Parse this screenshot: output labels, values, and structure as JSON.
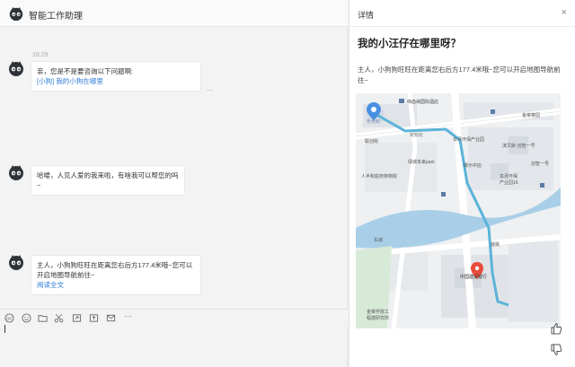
{
  "app": {
    "title": "智能工作助理"
  },
  "chat": {
    "timestamp": "18:29",
    "messages": [
      {
        "line1": "亲，您是不是要咨询以下问题啊:",
        "link": "[小狗] 我的小狗在哪里"
      },
      {
        "text": "哈喽，人见人爱的我来啦，有啥我可以帮您的吗~"
      },
      {
        "line1": "主人，小狗狗旺旺在距离您右后方177.4米哦~您可以",
        "line2": "开启地图导航前往~",
        "link": "阅读全文"
      }
    ],
    "more": "..."
  },
  "toolbar": {
    "icons": [
      "emoji-icon",
      "smile-icon",
      "folder-icon",
      "scissors-icon",
      "forward-icon",
      "image-icon",
      "mail-icon",
      "more-icon"
    ],
    "more_label": "···"
  },
  "detail": {
    "header": "详情",
    "close": "×",
    "title": "我的小汪仔在哪里呀？",
    "body": "主人，小狗狗旺旺在距离您右后方177.4米哦~您可以开启地图导航前往~",
    "map": {
      "labels": {
        "hotel": "缔齿纳国际酒店",
        "sc": "乐天纪",
        "park_road": "联创街",
        "xianzhi": "鲜知处",
        "green_park": "绿城未来park",
        "residence": "人半和庭宛物物院",
        "industrial": "阜月环保产业园",
        "innovation": "滨贝斯·创智一号",
        "fitness": "金菜菜园",
        "store": "创智一号",
        "store2": "碳示中店",
        "industrial2": "阜月环保",
        "industrial3": "产业园16",
        "street2": "东城",
        "bank": "中国建设银行",
        "school1": "金菜学院工",
        "school2": "程建研究所",
        "road3": "嘉兴路",
        "road4": "鹿路"
      }
    }
  },
  "colors": {
    "route": "#5bb3d9",
    "river": "#a9cfe8",
    "pin": "#e84c3d",
    "start": "#4a90e2"
  }
}
